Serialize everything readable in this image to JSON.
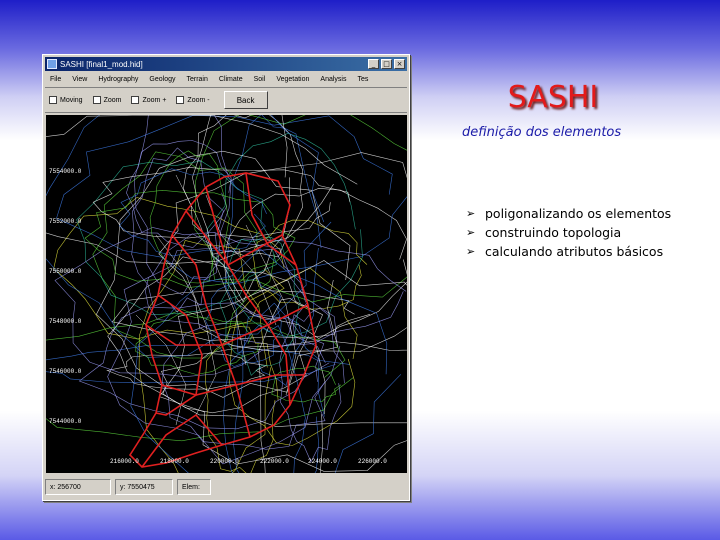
{
  "window": {
    "title": "SASHI [final1_mod.hid]",
    "controls": {
      "minimize": "_",
      "maximize": "□",
      "close": "×"
    }
  },
  "menu": [
    "File",
    "View",
    "Hydrography",
    "Geology",
    "Terrain",
    "Climate",
    "Soil",
    "Vegetation",
    "Analysis",
    "Tes"
  ],
  "toolbar": {
    "checks": [
      "Moving",
      "Zoom",
      "Zoom +",
      "Zoom -"
    ],
    "back_label": "Back"
  },
  "map": {
    "y_ticks": [
      "7554000.0",
      "7552000.0",
      "7550000.0",
      "7548000.0",
      "7546000.0",
      "7544000.0"
    ],
    "x_ticks": [
      "216000.0",
      "218000.0",
      "220000.0",
      "222000.0",
      "224000.0",
      "226000.0"
    ]
  },
  "statusbar": {
    "x_readout": "x: 256700",
    "y_readout": "y: 7550475",
    "elem_readout": "Elem:"
  },
  "slide": {
    "title": "SASHI",
    "subtitle": "definição dos elementos",
    "bullets": [
      "poligonalizando os elementos",
      "construindo topologia",
      "calculando atributos básicos"
    ]
  },
  "colors": {
    "accent_title": "#e31a1a",
    "subtitle": "#1a1aa8",
    "map_background": "#000000",
    "boundary": "#e02020"
  }
}
